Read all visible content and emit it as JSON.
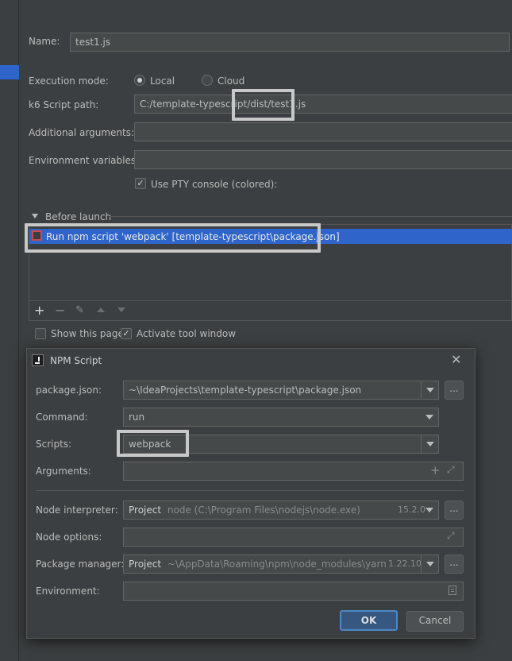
{
  "run_config": {
    "name_label": "Name:",
    "name_value": "test1.js",
    "execution_mode_label": "Execution mode:",
    "mode_local": "Local",
    "mode_cloud": "Cloud",
    "script_path_label": "k6 Script path:",
    "script_path_value": "C:/template-typescript/dist/test1.js",
    "additional_args_label": "Additional arguments:",
    "env_vars_label": "Environment variables:",
    "pty_label": "Use PTY console (colored):",
    "before_launch_label": "Before launch",
    "task_label": "Run npm script 'webpack' [template-typescript\\package.json]",
    "show_page_label": "Show this page",
    "activate_tool_label": "Activate tool window"
  },
  "toolbar_icons": [
    "plus-icon",
    "minus-icon",
    "edit-icon",
    "move-up-icon",
    "move-down-icon"
  ],
  "npm_dialog": {
    "title": "NPM Script",
    "package_json_label": "package.json:",
    "package_json_value": "~\\IdeaProjects\\template-typescript\\package.json",
    "command_label": "Command:",
    "command_value": "run",
    "scripts_label": "Scripts:",
    "scripts_value": "webpack",
    "arguments_label": "Arguments:",
    "node_interp_label": "Node interpreter:",
    "node_interp_kind": "Project",
    "node_interp_path": "node (C:\\Program Files\\nodejs\\node.exe)",
    "node_interp_version": "15.2.0",
    "node_options_label": "Node options:",
    "pkg_manager_label": "Package manager:",
    "pkg_manager_kind": "Project",
    "pkg_manager_path": "~\\AppData\\Roaming\\npm\\node_modules\\yarn",
    "pkg_manager_version": "1.22.10",
    "environment_label": "Environment:",
    "ok_label": "OK",
    "cancel_label": "Cancel",
    "dots": "..."
  },
  "colors": {
    "background": "#3c3f41",
    "selection": "#2f65ca",
    "highlight_box": "#c8c8c8"
  }
}
